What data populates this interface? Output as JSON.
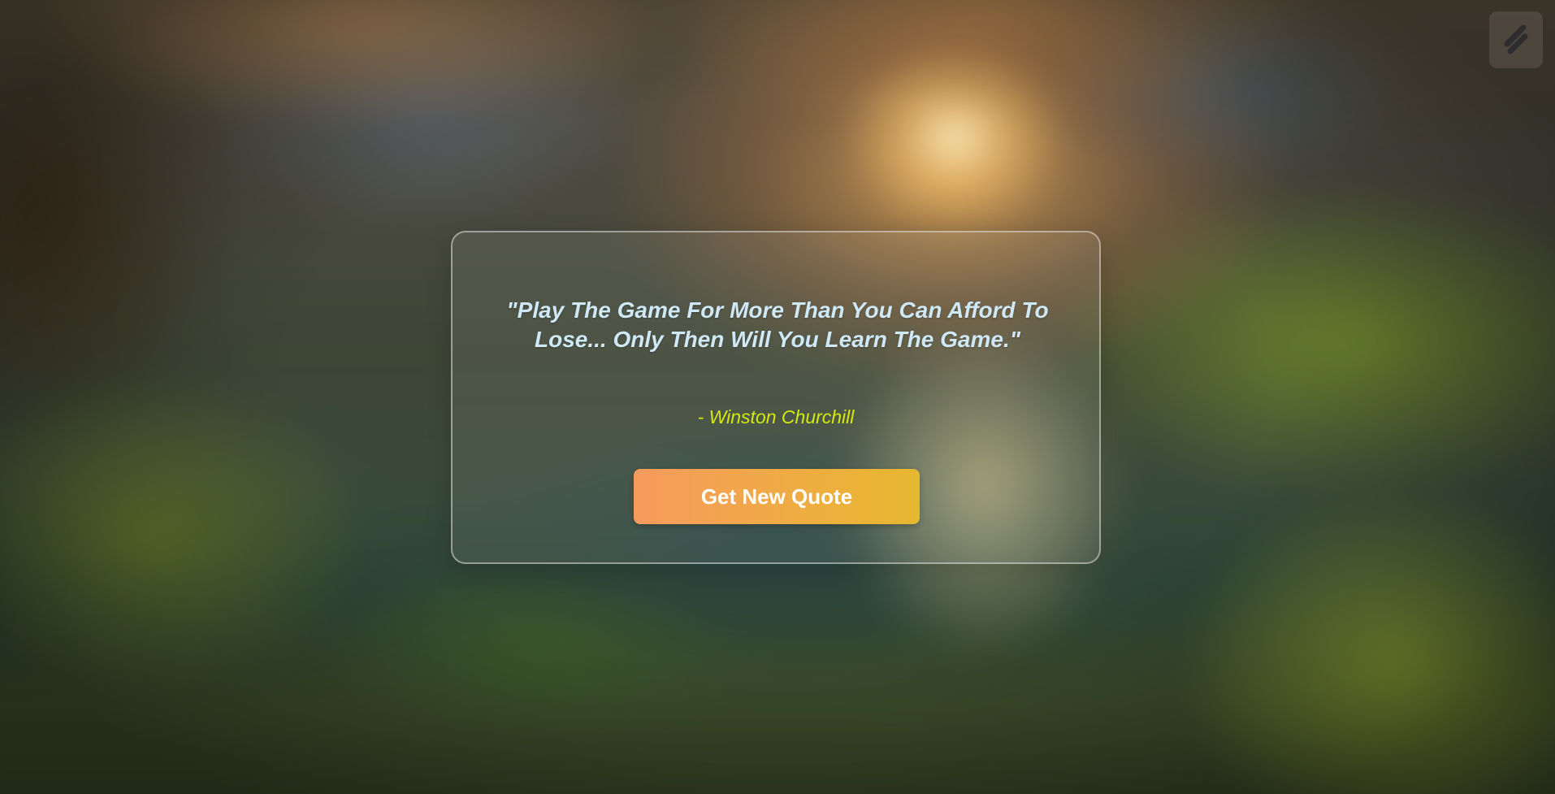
{
  "quote": {
    "text": "\"Play The Game For More Than You Can Afford To Lose... Only Then Will You Learn The Game.\"",
    "author": "- Winston Churchill"
  },
  "actions": {
    "new_quote_label": "Get New Quote"
  },
  "corner_badge": {
    "icon": "stripe-s-logo-icon"
  },
  "colors": {
    "quote_text": "#cfe8f6",
    "author_text": "#d5e810",
    "button_gradient_start": "#f79a5e",
    "button_gradient_end": "#e6b830",
    "button_text": "#ffffff"
  }
}
